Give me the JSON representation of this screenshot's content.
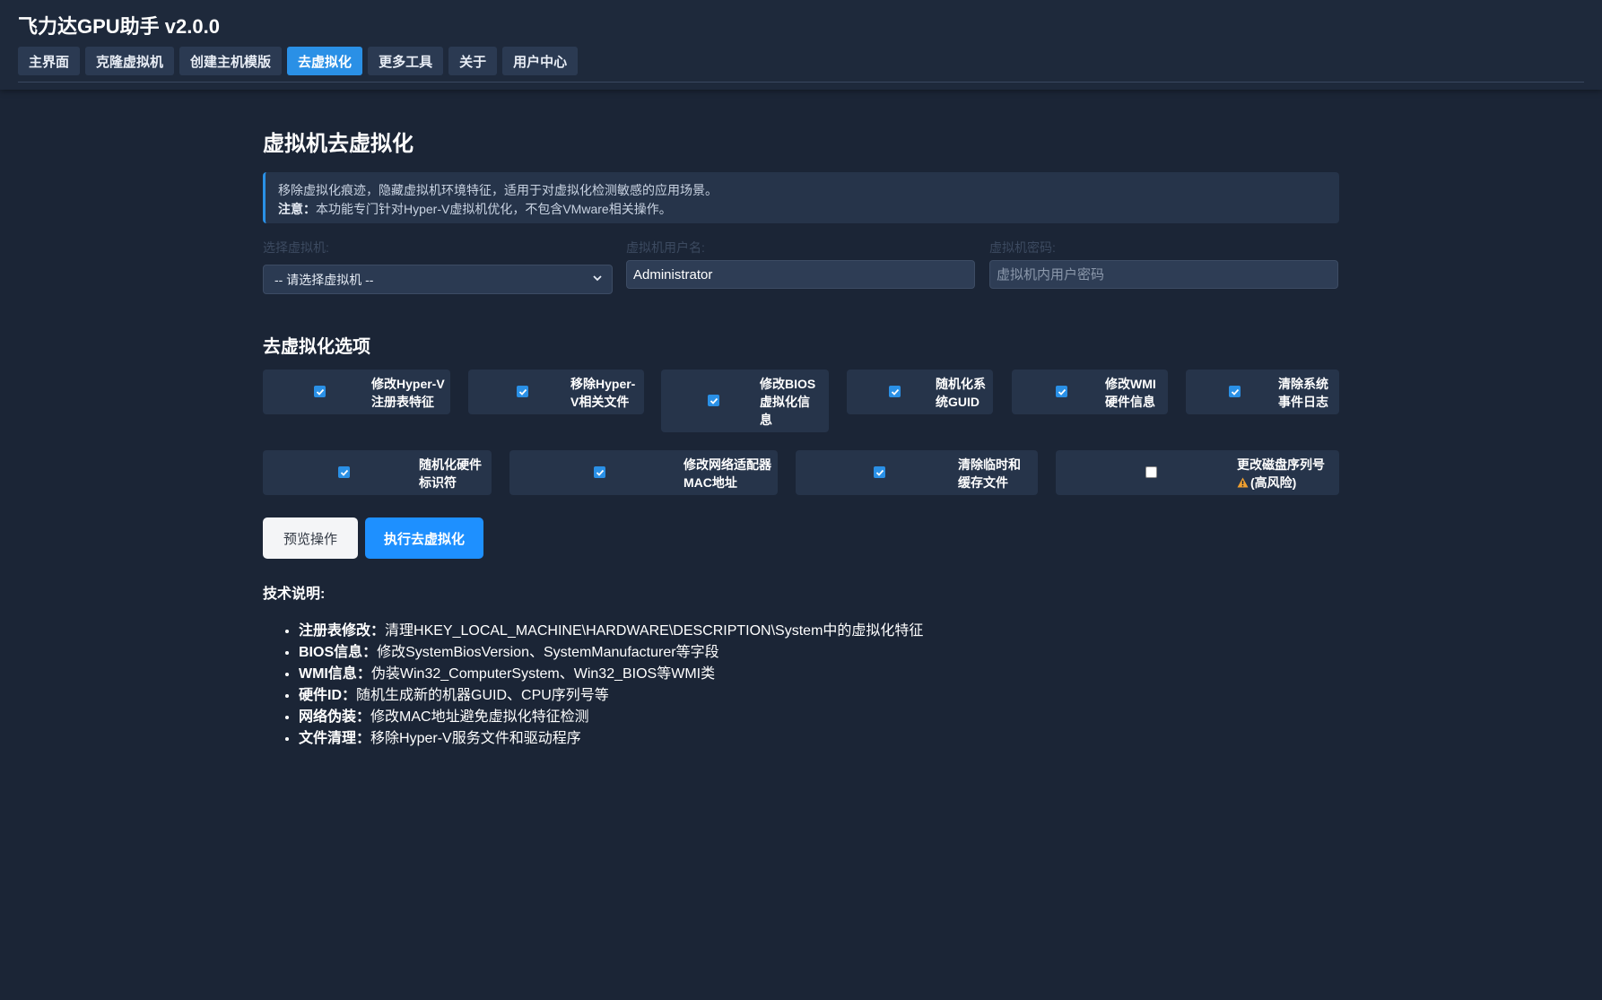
{
  "app": {
    "title": "飞力达GPU助手 v2.0.0"
  },
  "tabs": [
    {
      "label": "主界面"
    },
    {
      "label": "克隆虚拟机"
    },
    {
      "label": "创建主机模版"
    },
    {
      "label": "去虚拟化",
      "active": true
    },
    {
      "label": "更多工具"
    },
    {
      "label": "关于"
    },
    {
      "label": "用户中心"
    }
  ],
  "page": {
    "title": "虚拟机去虚拟化"
  },
  "notice": {
    "line1": "移除虚拟化痕迹，隐藏虚拟机环境特征，适用于对虚拟化检测敏感的应用场景。",
    "note_label": "注意：",
    "note_text": "本功能专门针对Hyper-V虚拟机优化，不包含VMware相关操作。"
  },
  "form": {
    "vm_label": "选择虚拟机:",
    "vm_selected": "-- 请选择虚拟机 --",
    "user_label": "虚拟机用户名:",
    "user_value": "Administrator",
    "password_label": "虚拟机密码:",
    "password_placeholder": "虚拟机内用户密码"
  },
  "options": {
    "title": "去虚拟化选项",
    "items": [
      {
        "line1": "修改Hyper-V",
        "line2": "注册表特征",
        "checked": true
      },
      {
        "line1": "移除Hyper-",
        "line2": "V相关文件",
        "checked": true
      },
      {
        "line1": "修改BIOS",
        "line2": "虚拟化信",
        "line3": "息",
        "checked": true
      },
      {
        "line1": "随机化系",
        "line2": "统GUID",
        "checked": true
      },
      {
        "line1": "修改WMI",
        "line2": "硬件信息",
        "checked": true
      },
      {
        "line1": "清除系统",
        "line2": "事件日志",
        "checked": true
      },
      {
        "line1": "随机化硬件",
        "line2": "标识符",
        "checked": true
      },
      {
        "line1": "修改网络适配器",
        "line2": "MAC地址",
        "checked": true
      },
      {
        "line1": "清除临时和",
        "line2": "缓存文件",
        "checked": true
      },
      {
        "line1": "更改磁盘序列号",
        "line2": "(高风险)",
        "checked": false,
        "icon": "warning-icon"
      }
    ]
  },
  "buttons": {
    "preview": "预览操作",
    "execute": "执行去虚拟化"
  },
  "tech": {
    "title": "技术说明:",
    "items": [
      {
        "label": "注册表修改：",
        "text": "清理HKEY_LOCAL_MACHINE\\HARDWARE\\DESCRIPTION\\System中的虚拟化特征"
      },
      {
        "label": "BIOS信息：",
        "text": "修改SystemBiosVersion、SystemManufacturer等字段"
      },
      {
        "label": "WMI信息：",
        "text": "伪装Win32_ComputerSystem、Win32_BIOS等WMI类"
      },
      {
        "label": "硬件ID：",
        "text": "随机生成新的机器GUID、CPU序列号等"
      },
      {
        "label": "网络伪装：",
        "text": "修改MAC地址避免虚拟化特征检测"
      },
      {
        "label": "文件清理：",
        "text": "移除Hyper-V服务文件和驱动程序"
      }
    ]
  },
  "colors": {
    "background": "#1b2536",
    "panel": "#26344a",
    "accent": "#2a90e6",
    "warning": "#f0a030"
  }
}
